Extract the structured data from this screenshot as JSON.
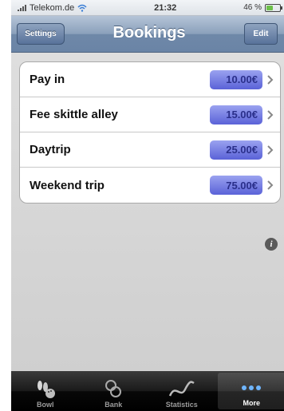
{
  "status_bar": {
    "carrier": "Telekom.de",
    "time": "21:32",
    "battery": "46 %"
  },
  "navbar": {
    "back_label": "Settings",
    "title": "Bookings",
    "edit_label": "Edit"
  },
  "bookings": [
    {
      "label": "Pay in",
      "amount": "10.00€"
    },
    {
      "label": "Fee skittle alley",
      "amount": "15.00€"
    },
    {
      "label": "Daytrip",
      "amount": "25.00€"
    },
    {
      "label": "Weekend trip",
      "amount": "75.00€"
    }
  ],
  "tabbar": {
    "tabs": [
      {
        "label": "Bowl",
        "icon": "bowling-pins-icon"
      },
      {
        "label": "Bank",
        "icon": "coins-icon"
      },
      {
        "label": "Statistics",
        "icon": "statistics-curve-icon"
      },
      {
        "label": "More",
        "icon": "more-dots-icon",
        "active": true
      }
    ]
  },
  "colors": {
    "nav_blue": "#6f88a8",
    "amount_badge": "#5a62d8",
    "tabbar_bg": "#000000"
  }
}
